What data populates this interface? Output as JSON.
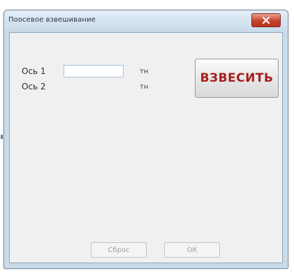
{
  "window": {
    "title": "Поосевое взвешивание",
    "close_icon": "close-x-icon"
  },
  "axles": [
    {
      "label": "Ось 1",
      "value": "",
      "unit": "тн"
    },
    {
      "label": "Ось 2",
      "value": "",
      "unit": "тн"
    }
  ],
  "buttons": {
    "weigh_label": "ВЗВЕСИТЬ",
    "reset_label": "Сброс",
    "ok_label": "ОК"
  },
  "colors": {
    "weigh_text": "#a51e1e",
    "close_button": "#c7422a",
    "frame": "#c9dbe9"
  }
}
